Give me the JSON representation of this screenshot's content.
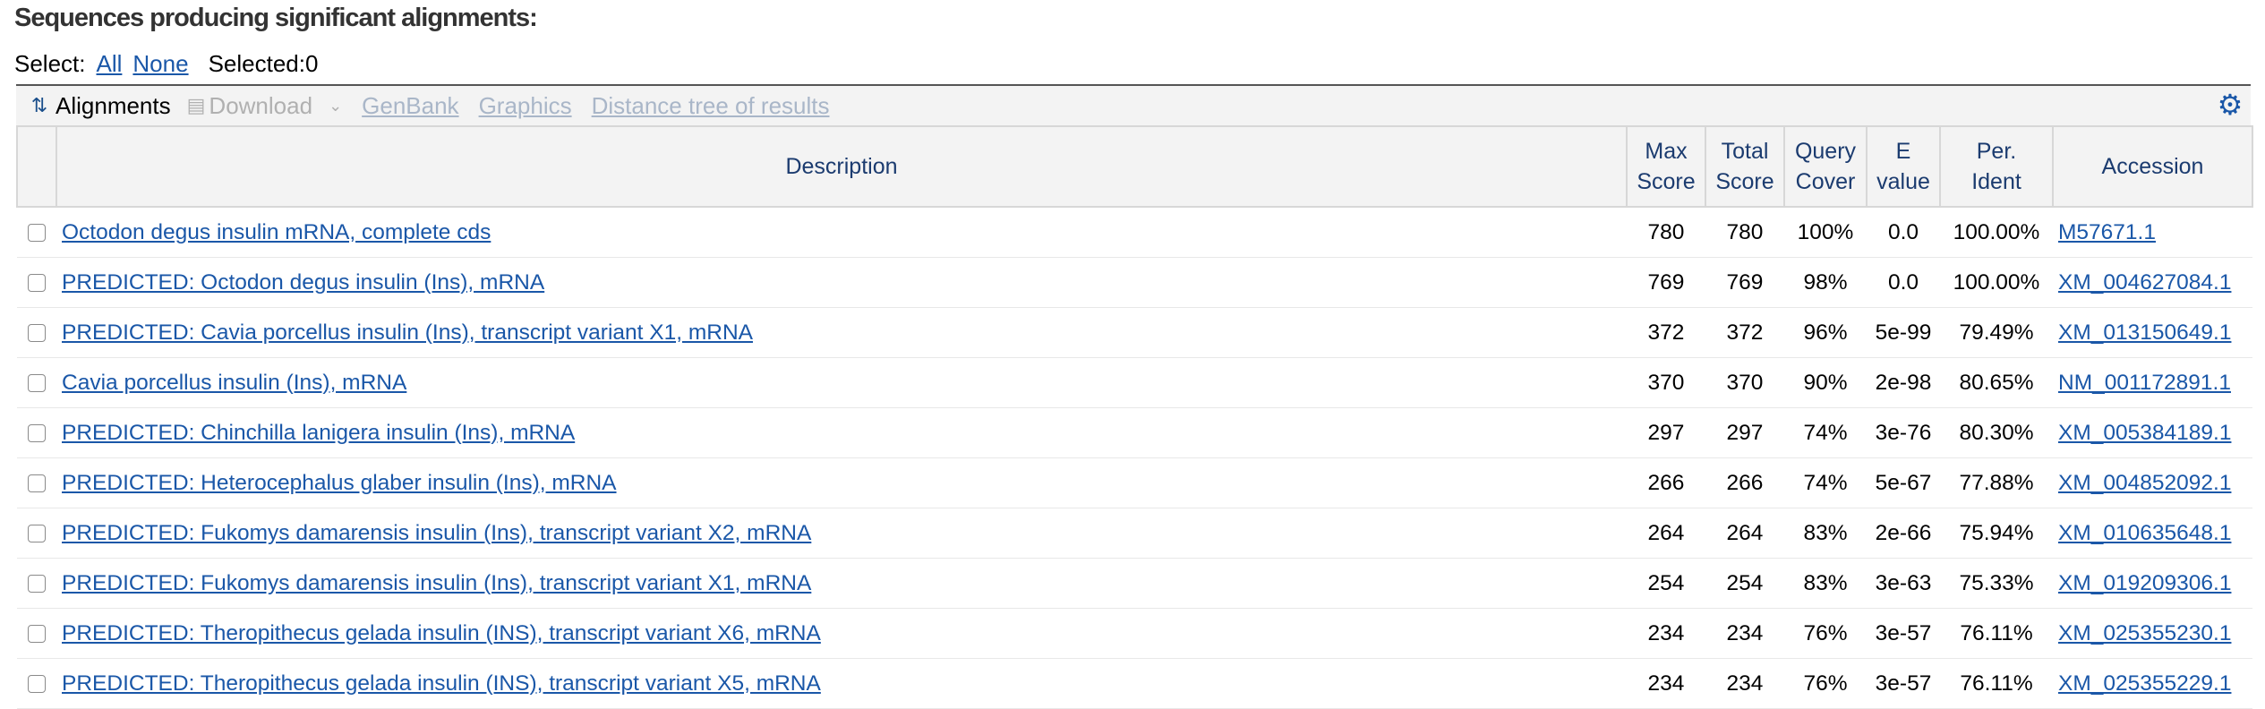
{
  "heading": "Sequences producing significant alignments:",
  "select": {
    "label": "Select:",
    "all": "All",
    "none": "None",
    "selected": "Selected:0"
  },
  "toolbar": {
    "alignments": "Alignments",
    "download": "Download",
    "genbank": "GenBank",
    "graphics": "Graphics",
    "distance_tree": "Distance tree of results"
  },
  "columns": {
    "description": "Description",
    "max_score_1": "Max",
    "max_score_2": "Score",
    "total_score_1": "Total",
    "total_score_2": "Score",
    "query_cover_1": "Query",
    "query_cover_2": "Cover",
    "evalue_1": "E",
    "evalue_2": "value",
    "per_ident_1": "Per.",
    "per_ident_2": "Ident",
    "accession": "Accession"
  },
  "rows": [
    {
      "description": "Octodon degus insulin mRNA, complete cds",
      "max_score": "780",
      "total_score": "780",
      "query_cover": "100%",
      "evalue": "0.0",
      "per_ident": "100.00%",
      "accession": "M57671.1"
    },
    {
      "description": "PREDICTED: Octodon degus insulin (Ins), mRNA",
      "max_score": "769",
      "total_score": "769",
      "query_cover": "98%",
      "evalue": "0.0",
      "per_ident": "100.00%",
      "accession": "XM_004627084.1"
    },
    {
      "description": "PREDICTED: Cavia porcellus insulin (Ins), transcript variant X1, mRNA",
      "max_score": "372",
      "total_score": "372",
      "query_cover": "96%",
      "evalue": "5e-99",
      "per_ident": "79.49%",
      "accession": "XM_013150649.1"
    },
    {
      "description": "Cavia porcellus insulin (Ins), mRNA",
      "max_score": "370",
      "total_score": "370",
      "query_cover": "90%",
      "evalue": "2e-98",
      "per_ident": "80.65%",
      "accession": "NM_001172891.1"
    },
    {
      "description": "PREDICTED: Chinchilla lanigera insulin (Ins), mRNA",
      "max_score": "297",
      "total_score": "297",
      "query_cover": "74%",
      "evalue": "3e-76",
      "per_ident": "80.30%",
      "accession": "XM_005384189.1"
    },
    {
      "description": "PREDICTED: Heterocephalus glaber insulin (Ins), mRNA",
      "max_score": "266",
      "total_score": "266",
      "query_cover": "74%",
      "evalue": "5e-67",
      "per_ident": "77.88%",
      "accession": "XM_004852092.1"
    },
    {
      "description": "PREDICTED: Fukomys damarensis insulin (Ins), transcript variant X2, mRNA",
      "max_score": "264",
      "total_score": "264",
      "query_cover": "83%",
      "evalue": "2e-66",
      "per_ident": "75.94%",
      "accession": "XM_010635648.1"
    },
    {
      "description": "PREDICTED: Fukomys damarensis insulin (Ins), transcript variant X1, mRNA",
      "max_score": "254",
      "total_score": "254",
      "query_cover": "83%",
      "evalue": "3e-63",
      "per_ident": "75.33%",
      "accession": "XM_019209306.1"
    },
    {
      "description": "PREDICTED: Theropithecus gelada insulin (INS), transcript variant X6, mRNA",
      "max_score": "234",
      "total_score": "234",
      "query_cover": "76%",
      "evalue": "3e-57",
      "per_ident": "76.11%",
      "accession": "XM_025355230.1"
    },
    {
      "description": "PREDICTED: Theropithecus gelada insulin (INS), transcript variant X5, mRNA",
      "max_score": "234",
      "total_score": "234",
      "query_cover": "76%",
      "evalue": "3e-57",
      "per_ident": "76.11%",
      "accession": "XM_025355229.1"
    }
  ],
  "colors": {
    "link": "#1a57a8",
    "header_text": "#1b3b6f",
    "disabled_link": "#a9b6c8"
  },
  "icons": {
    "alignments": "alignments-sort-icon",
    "download": "download-icon",
    "settings": "gear-icon"
  }
}
